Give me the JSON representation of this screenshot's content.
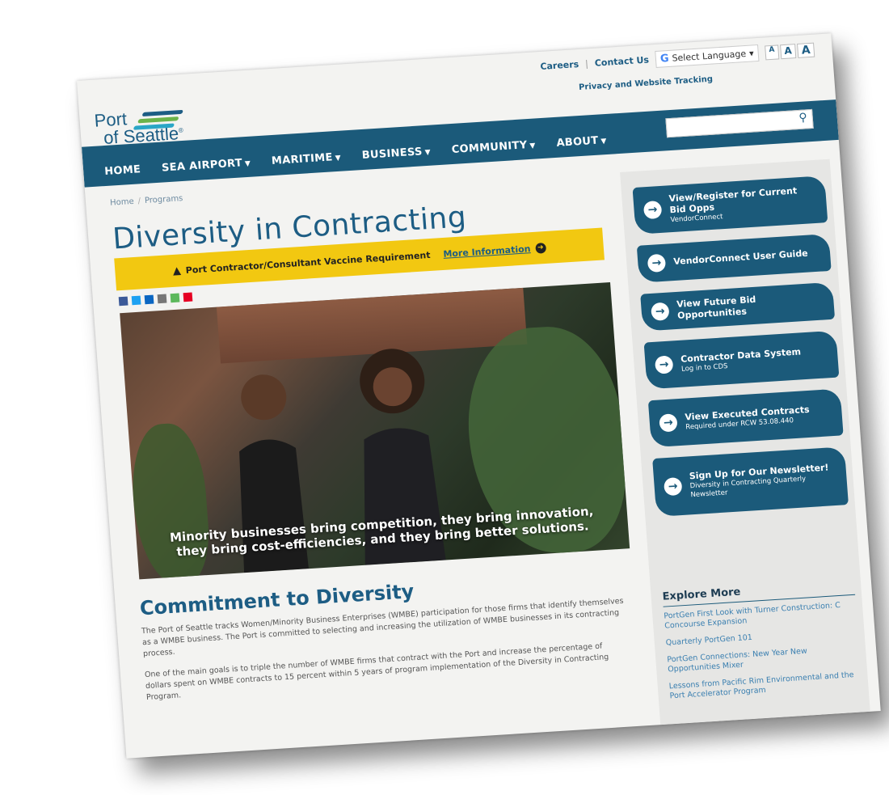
{
  "utility": {
    "careers": "Careers",
    "contact": "Contact Us",
    "language": "Select Language",
    "font_sizes": [
      "A",
      "A",
      "A"
    ],
    "privacy": "Privacy and Website Tracking"
  },
  "logo": {
    "line1": "Port",
    "line2": "of Seattle",
    "reg": "®"
  },
  "nav": {
    "items": [
      "HOME",
      "SEA AIRPORT",
      "MARITIME",
      "BUSINESS",
      "COMMUNITY",
      "ABOUT"
    ]
  },
  "breadcrumb": [
    "Home",
    "Programs"
  ],
  "title": "Diversity in Contracting",
  "alert": {
    "text": "Port Contractor/Consultant Vaccine Requirement",
    "link": "More Information"
  },
  "hero": {
    "caption_line1": "Minority businesses bring competition, they bring innovation,",
    "caption_line2": "they bring cost-efficiencies, and they bring better solutions."
  },
  "section": {
    "heading": "Commitment to Diversity",
    "para1": "The Port of Seattle tracks Women/Minority Business Enterprises (WMBE) participation for those firms that identify themselves as a WMBE business. The Port is committed to selecting and increasing the utilization of WMBE businesses in its contracting process.",
    "para2": "One of the main goals is to triple the number of WMBE firms that contract with the Port and increase the percentage of dollars spent on WMBE contracts to 15 percent within 5 years of program implementation of the Diversity in Contracting Program."
  },
  "sidebar": {
    "buttons": [
      {
        "label": "View/Register for Current Bid Opps",
        "sub": "VendorConnect"
      },
      {
        "label": "VendorConnect User Guide",
        "sub": ""
      },
      {
        "label": "View Future Bid Opportunities",
        "sub": ""
      },
      {
        "label": "Contractor Data System",
        "sub": "Log in to CDS"
      },
      {
        "label": "View Executed Contracts",
        "sub": "Required under RCW 53.08.440"
      },
      {
        "label": "Sign Up for Our Newsletter!",
        "sub": "Diversity in Contracting Quarterly Newsletter"
      }
    ],
    "explore_heading": "Explore More",
    "explore_links": [
      "PortGen First Look with Turner Construction: C Concourse Expansion",
      "Quarterly PortGen 101",
      "PortGen Connections: New Year New Opportunities Mixer",
      "Lessons from Pacific Rim Environmental and the Port Accelerator Program"
    ]
  },
  "colors": {
    "navy": "#1b5a7a",
    "accent_yellow": "#f2c811",
    "link_blue": "#3a7fb0"
  }
}
